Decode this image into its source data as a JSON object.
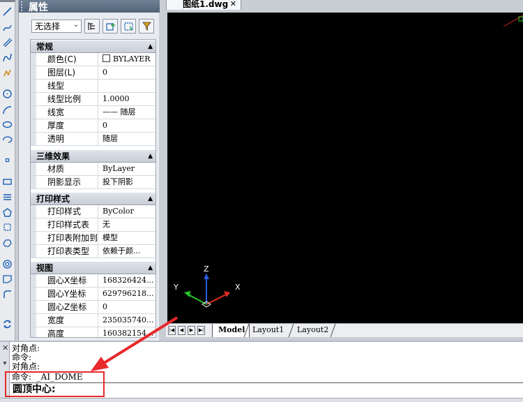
{
  "properties_panel": {
    "title": "属性",
    "selection": "无选择",
    "tools": [
      "toggle-pickadd-icon",
      "select-objects-icon",
      "quick-select-icon",
      "filter-icon"
    ],
    "groups": [
      {
        "title": "常规",
        "rows": [
          {
            "name": "颜色(C)",
            "value": "BYLAYER",
            "swatch": true
          },
          {
            "name": "图层(L)",
            "value": "0"
          },
          {
            "name": "线型",
            "value": ""
          },
          {
            "name": "线型比例",
            "value": "1.0000"
          },
          {
            "name": "线宽",
            "value": "—— 随层"
          },
          {
            "name": "厚度",
            "value": "0"
          },
          {
            "name": "透明",
            "value": "随层"
          }
        ]
      },
      {
        "title": "三维效果",
        "rows": [
          {
            "name": "材质",
            "value": "ByLayer"
          },
          {
            "name": "阴影显示",
            "value": "投下阴影"
          }
        ]
      },
      {
        "title": "打印样式",
        "rows": [
          {
            "name": "打印样式",
            "value": "ByColor"
          },
          {
            "name": "打印样式表",
            "value": "无"
          },
          {
            "name": "打印表附加到",
            "value": "模型"
          },
          {
            "name": "打印表类型",
            "value": "依赖于颜..."
          }
        ]
      },
      {
        "title": "视图",
        "rows": [
          {
            "name": "圆心X坐标",
            "value": "168326424..."
          },
          {
            "name": "圆心Y坐标",
            "value": "629796218..."
          },
          {
            "name": "圆心Z坐标",
            "value": "0"
          },
          {
            "name": "宽度",
            "value": "235035740..."
          },
          {
            "name": "高度",
            "value": "160382154..."
          }
        ]
      }
    ]
  },
  "document": {
    "tab_label": "图纸1.dwg",
    "close_glyph": "✕"
  },
  "ucs": {
    "x_label": "X",
    "y_label": "Y",
    "z_label": "Z"
  },
  "layout_tabs": [
    "Model",
    "Layout1",
    "Layout2"
  ],
  "command": {
    "history": [
      "对角点:",
      "命令:",
      "对角点:",
      "命令:  _AI_DOME"
    ],
    "prompt": "圆顶中心:"
  },
  "colors": {
    "canvas_bg": "#000000",
    "annotation": "#e8292b",
    "panel_title_bg": "#5a6b80"
  }
}
